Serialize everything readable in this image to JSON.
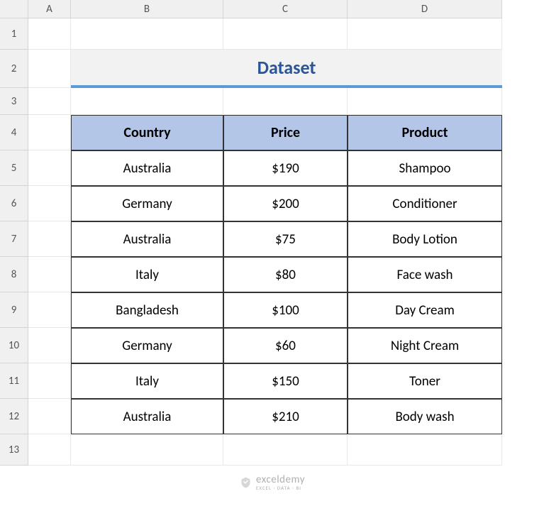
{
  "columns": [
    "A",
    "B",
    "C",
    "D"
  ],
  "rows": [
    "1",
    "2",
    "3",
    "4",
    "5",
    "6",
    "7",
    "8",
    "9",
    "10",
    "11",
    "12",
    "13"
  ],
  "title": "Dataset",
  "table": {
    "headers": [
      "Country",
      "Price",
      "Product"
    ],
    "data": [
      [
        "Australia",
        "$190",
        "Shampoo"
      ],
      [
        "Germany",
        "$200",
        "Conditioner"
      ],
      [
        "Australia",
        "$75",
        "Body Lotion"
      ],
      [
        "Italy",
        "$80",
        "Face wash"
      ],
      [
        "Bangladesh",
        "$100",
        "Day Cream"
      ],
      [
        "Germany",
        "$60",
        "Night Cream"
      ],
      [
        "Italy",
        "$150",
        "Toner"
      ],
      [
        "Australia",
        "$210",
        "Body wash"
      ]
    ]
  },
  "watermark": {
    "main": "exceldemy",
    "sub": "EXCEL · DATA · BI"
  }
}
